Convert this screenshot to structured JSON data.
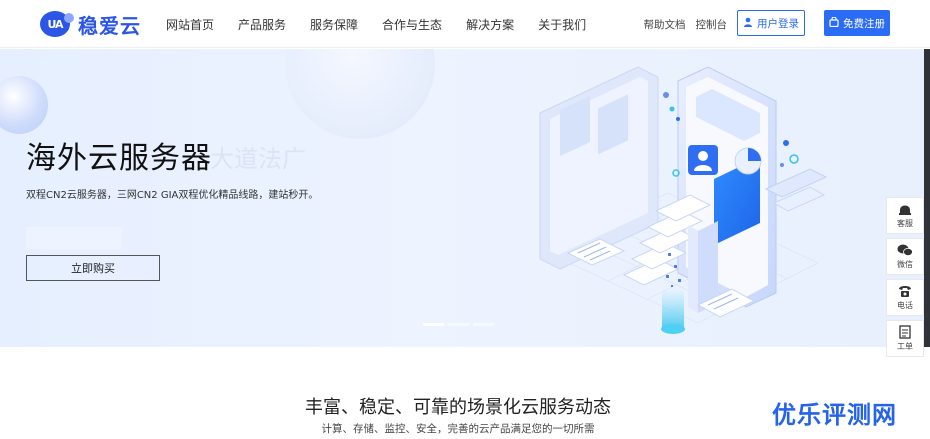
{
  "brand": {
    "logo_mark": "UA",
    "name": "稳爱云",
    "color": "#2b56e6"
  },
  "nav": {
    "items": [
      {
        "label": "网站首页"
      },
      {
        "label": "产品服务"
      },
      {
        "label": "服务保障"
      },
      {
        "label": "合作与生态"
      },
      {
        "label": "解决方案"
      },
      {
        "label": "关于我们"
      }
    ]
  },
  "header_right": {
    "help_docs": "帮助文档",
    "console": "控制台",
    "login_label": "用户登录",
    "register_label": "免费注册",
    "login_icon": "user-icon",
    "register_icon": "bag-icon"
  },
  "hero": {
    "title": "海外云服务器",
    "faint_text": "大道法广",
    "subtitle": "双程CN2云服务器，三网CN2 GIA双程优化精品线路，建站秒开。",
    "buy_label": "立即购买",
    "carousel": {
      "slides": 3,
      "active": 1
    },
    "illustration": "cloud-server-isometric-illustration"
  },
  "side_tools": [
    {
      "label": "客服",
      "icon": "headset-icon"
    },
    {
      "label": "微信",
      "icon": "wechat-icon"
    },
    {
      "label": "电话",
      "icon": "phone-icon"
    },
    {
      "label": "工单",
      "icon": "ticket-icon"
    }
  ],
  "section": {
    "title": "丰富、稳定、可靠的场景化云服务动态",
    "subtitle": "计算、存储、监控、安全，完善的云产品满足您的一切所需"
  },
  "watermark": "优乐评测网",
  "colors": {
    "accent": "#2b6cf6",
    "hero_bg": "#e9f1ff"
  }
}
